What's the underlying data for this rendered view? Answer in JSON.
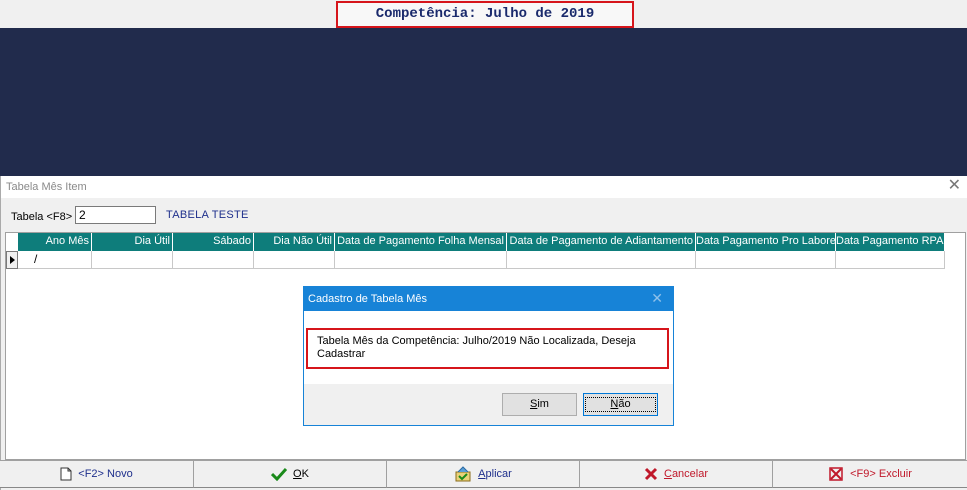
{
  "header": {
    "competencia": "Competência: Julho de 2019"
  },
  "window": {
    "title": "Tabela Mês Item",
    "close_glyph": "✕",
    "tabela_label": "Tabela <F8>",
    "tabela_value": "2",
    "tabela_desc": "TABELA TESTE"
  },
  "grid": {
    "columns": [
      "Ano Mês",
      "Dia Útil",
      "Sábado",
      "Dia Não Útil",
      "Data de Pagamento Folha Mensal",
      "Data de Pagamento de Adiantamento",
      "Data Pagamento Pro Labore",
      "Data Pagamento RPA"
    ],
    "row": [
      "/",
      "",
      "",
      "",
      "",
      "",
      "",
      ""
    ]
  },
  "dialog": {
    "title": "Cadastro de Tabela Mês",
    "close_glyph": "✕",
    "message": "Tabela Mês da Competência: Julho/2019 Não Localizada, Deseja Cadastrar",
    "sim_ul": "S",
    "sim_rest": "im",
    "nao_ul": "N",
    "nao_rest": "ão"
  },
  "toolbar": {
    "novo": "<F2> Novo",
    "ok_ul": "O",
    "ok_rest": "K",
    "aplicar_ul": "A",
    "aplicar_rest": "plicar",
    "cancelar_ul": "C",
    "cancelar_rest": "ancelar",
    "excluir": "<F9> Excluir"
  },
  "colors": {
    "navy_band": "#212b4c",
    "grid_header": "#0e7d7b",
    "dialog_title": "#1783d7",
    "highlight_red": "#d6151b"
  }
}
